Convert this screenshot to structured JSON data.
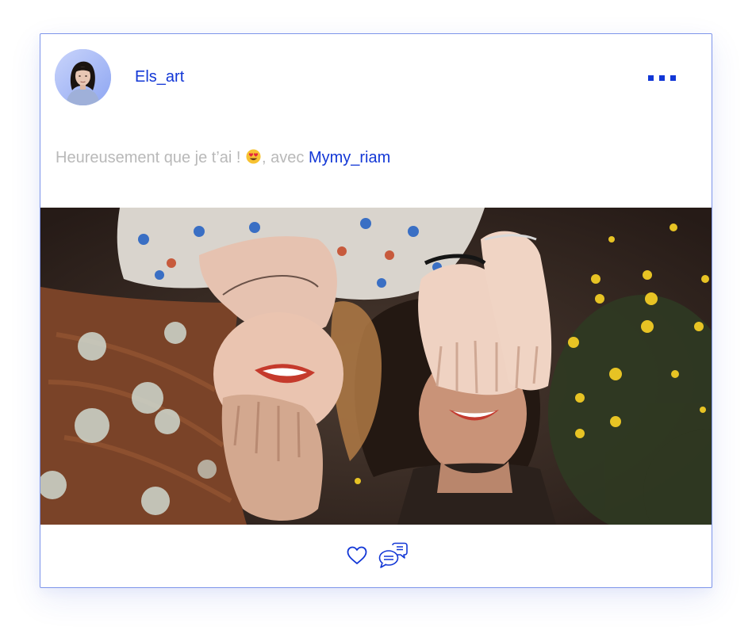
{
  "post": {
    "author": {
      "username": "Els_art",
      "avatar_icon": "avatar-portrait"
    },
    "menu_icon": "more-dots-icon",
    "caption": {
      "text": "Heureusement que je t’ai ! ",
      "emoji": "heart-eyes-emoji",
      "with_text": ", avec ",
      "mention": "Mymy_riam"
    },
    "photo": {
      "subject": "two-women-lying-in-grass-covering-eyes"
    },
    "actions": {
      "like_icon": "heart-icon",
      "comment_icon": "chat-bubbles-icon"
    },
    "colors": {
      "accent": "#1237d6",
      "card_border": "#7e95ea",
      "caption_gray": "#b9b9b9",
      "photo_background": "#3a2a24"
    }
  }
}
